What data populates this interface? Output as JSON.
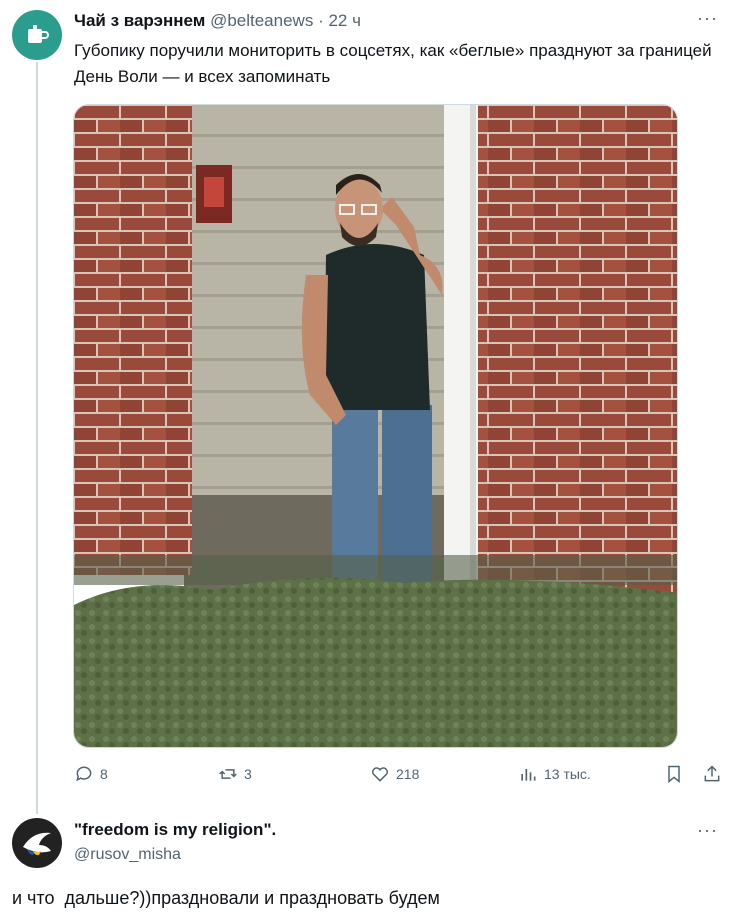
{
  "tweet": {
    "author_name": "Чай з варэннем",
    "author_handle": "@belteanews",
    "time": "· 22 ч",
    "text": "Губопику поручили мониторить в соцсетях, как «беглые» празднуют за границей День Воли — и всех запоминать",
    "stats": {
      "replies": "8",
      "reposts": "3",
      "likes": "218",
      "views": "13 тыс."
    },
    "more_label": "···"
  },
  "reply": {
    "author_name": "\"freedom is my religion\".",
    "author_handle": "@rusov_misha",
    "text": "и что  дальше?))праздновали и праздновать будем",
    "more_label": "···"
  },
  "colors": {
    "muted": "#536471",
    "border": "#cfd9de",
    "avatar1": "#2a9d8f",
    "brick": "#9a4a3a"
  },
  "icons": [
    "cup-icon",
    "reply-icon",
    "repost-icon",
    "like-icon",
    "views-icon",
    "bookmark-icon",
    "share-icon",
    "dove-icon"
  ]
}
